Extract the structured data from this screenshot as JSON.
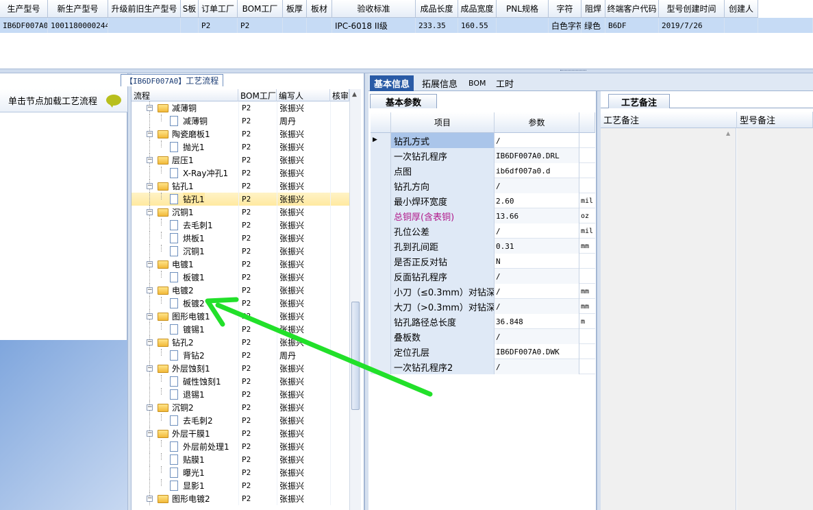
{
  "top_grid": {
    "columns": [
      "生产型号",
      "新生产型号",
      "升级前旧生产型号",
      "S板",
      "订单工厂",
      "BOM工厂",
      "板厚",
      "板材",
      "验收标准",
      "成品长度",
      "成品宽度",
      "PNL规格",
      "字符",
      "阻焊",
      "终端客户代码",
      "型号创建时间",
      "创建人"
    ],
    "row": [
      "IB6DF007A0",
      "10011800002444",
      "",
      "",
      "P2",
      "P2",
      "",
      "",
      "IPC-6018 II级",
      "233.35",
      "160.55",
      "",
      "白色字符",
      "绿色",
      "B6DF",
      "2019/7/26",
      ""
    ]
  },
  "left_panel": {
    "load_label": "单击节点加载工艺流程"
  },
  "process_panel": {
    "title_code": "【IB6DF007A0】",
    "title_text": "工艺流程",
    "headers": [
      "流程",
      "BOM工厂",
      "编写人",
      "核审"
    ],
    "rows": [
      {
        "name": "减薄铜",
        "factory": "P2",
        "writer": "张振兴",
        "type": "folder",
        "level": 0
      },
      {
        "name": "减薄铜",
        "factory": "P2",
        "writer": "周丹",
        "type": "doc",
        "level": 1
      },
      {
        "name": "陶瓷磨板1",
        "factory": "P2",
        "writer": "张振兴",
        "type": "folder",
        "level": 0
      },
      {
        "name": "抛光1",
        "factory": "P2",
        "writer": "张振兴",
        "type": "doc",
        "level": 1
      },
      {
        "name": "层压1",
        "factory": "P2",
        "writer": "张振兴",
        "type": "folder",
        "level": 0
      },
      {
        "name": "X-Ray冲孔1",
        "factory": "P2",
        "writer": "张振兴",
        "type": "doc",
        "level": 1
      },
      {
        "name": "钻孔1",
        "factory": "P2",
        "writer": "张振兴",
        "type": "folder",
        "level": 0
      },
      {
        "name": "钻孔1",
        "factory": "P2",
        "writer": "张振兴",
        "type": "doc",
        "level": 1,
        "selected": true
      },
      {
        "name": "沉铜1",
        "factory": "P2",
        "writer": "张振兴",
        "type": "folder",
        "level": 0
      },
      {
        "name": "去毛刺1",
        "factory": "P2",
        "writer": "张振兴",
        "type": "doc",
        "level": 1
      },
      {
        "name": "烘板1",
        "factory": "P2",
        "writer": "张振兴",
        "type": "doc",
        "level": 1
      },
      {
        "name": "沉铜1",
        "factory": "P2",
        "writer": "张振兴",
        "type": "doc",
        "level": 1
      },
      {
        "name": "电镀1",
        "factory": "P2",
        "writer": "张振兴",
        "type": "folder",
        "level": 0
      },
      {
        "name": "板镀1",
        "factory": "P2",
        "writer": "张振兴",
        "type": "doc",
        "level": 1
      },
      {
        "name": "电镀2",
        "factory": "P2",
        "writer": "张振兴",
        "type": "folder",
        "level": 0
      },
      {
        "name": "板镀2",
        "factory": "P2",
        "writer": "张振兴",
        "type": "doc",
        "level": 1
      },
      {
        "name": "图形电镀1",
        "factory": "P2",
        "writer": "张振兴",
        "type": "folder",
        "level": 0
      },
      {
        "name": "镀锡1",
        "factory": "P2",
        "writer": "张振兴",
        "type": "doc",
        "level": 1
      },
      {
        "name": "钻孔2",
        "factory": "P2",
        "writer": "张振兴",
        "type": "folder",
        "level": 0
      },
      {
        "name": "背钻2",
        "factory": "P2",
        "writer": "周丹",
        "type": "doc",
        "level": 1
      },
      {
        "name": "外层蚀刻1",
        "factory": "P2",
        "writer": "张振兴",
        "type": "folder",
        "level": 0
      },
      {
        "name": "碱性蚀刻1",
        "factory": "P2",
        "writer": "张振兴",
        "type": "doc",
        "level": 1
      },
      {
        "name": "退锡1",
        "factory": "P2",
        "writer": "张振兴",
        "type": "doc",
        "level": 1
      },
      {
        "name": "沉铜2",
        "factory": "P2",
        "writer": "张振兴",
        "type": "folder",
        "level": 0
      },
      {
        "name": "去毛刺2",
        "factory": "P2",
        "writer": "张振兴",
        "type": "doc",
        "level": 1
      },
      {
        "name": "外层干膜1",
        "factory": "P2",
        "writer": "张振兴",
        "type": "folder",
        "level": 0
      },
      {
        "name": "外层前处理1",
        "factory": "P2",
        "writer": "张振兴",
        "type": "doc",
        "level": 1
      },
      {
        "name": "贴膜1",
        "factory": "P2",
        "writer": "张振兴",
        "type": "doc",
        "level": 1
      },
      {
        "name": "曝光1",
        "factory": "P2",
        "writer": "张振兴",
        "type": "doc",
        "level": 1
      },
      {
        "name": "显影1",
        "factory": "P2",
        "writer": "张振兴",
        "type": "doc",
        "level": 1
      },
      {
        "name": "图形电镀2",
        "factory": "P2",
        "writer": "张振兴",
        "type": "folder",
        "level": 0
      }
    ]
  },
  "right_tabs": [
    "基本信息",
    "拓展信息",
    "BOM",
    "工时"
  ],
  "basic_params": {
    "tab_label": "基本参数",
    "headers": [
      "项目",
      "参数"
    ],
    "rows": [
      {
        "item": "钻孔方式",
        "value": "/",
        "unit": ""
      },
      {
        "item": "一次钻孔程序",
        "value": "IB6DF007A0.DRL",
        "unit": ""
      },
      {
        "item": "点图",
        "value": "ib6df007a0.d",
        "unit": ""
      },
      {
        "item": "钻孔方向",
        "value": "/",
        "unit": ""
      },
      {
        "item": "最小焊环宽度",
        "value": "2.60",
        "unit": "mil"
      },
      {
        "item": "总铜厚(含表铜)",
        "value": "13.66",
        "unit": "oz",
        "highlight": true
      },
      {
        "item": "孔位公差",
        "value": "/",
        "unit": "mil"
      },
      {
        "item": "孔到孔间距",
        "value": "0.31",
        "unit": "mm"
      },
      {
        "item": "是否正反对钻",
        "value": "N",
        "unit": ""
      },
      {
        "item": "反面钻孔程序",
        "value": "/",
        "unit": ""
      },
      {
        "item": "小刀（≤0.3mm）对钻深度",
        "value": "/",
        "unit": "mm"
      },
      {
        "item": "大刀（>0.3mm）对钻深度",
        "value": "/",
        "unit": "mm"
      },
      {
        "item": "钻孔路径总长度",
        "value": "36.848",
        "unit": "m"
      },
      {
        "item": "叠板数",
        "value": "/",
        "unit": ""
      },
      {
        "item": "定位孔层",
        "value": "IB6DF007A0.DWK",
        "unit": ""
      },
      {
        "item": "一次钻孔程序2",
        "value": "/",
        "unit": ""
      }
    ]
  },
  "remarks": {
    "tab_label": "工艺备注",
    "headers": [
      "工艺备注",
      "型号备注"
    ]
  },
  "colors": {
    "accent": "#2a5ba6",
    "annotation_arrow": "#22e02a",
    "highlight_text": "#b0188a"
  }
}
